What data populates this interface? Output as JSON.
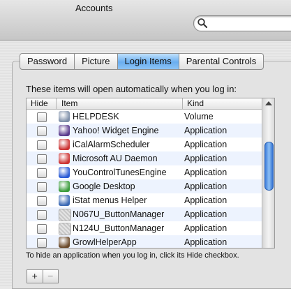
{
  "window": {
    "title": "Accounts"
  },
  "search": {
    "value": "",
    "placeholder": ""
  },
  "tabs": [
    {
      "label": "Password",
      "active": false
    },
    {
      "label": "Picture",
      "active": false
    },
    {
      "label": "Login Items",
      "active": true
    },
    {
      "label": "Parental Controls",
      "active": false
    }
  ],
  "login_items": {
    "instructions": "These items will open automatically when you log in:",
    "columns": {
      "hide": "Hide",
      "item": "Item",
      "kind": "Kind"
    },
    "rows": [
      {
        "name": "HELPDESK",
        "kind": "Volume",
        "icon": "volume-icon",
        "color": "#7d8ea8",
        "hidden": false
      },
      {
        "name": "Yahoo! Widget Engine",
        "kind": "Application",
        "icon": "yahoo-widget-icon",
        "color": "#5a3a8c",
        "hidden": false
      },
      {
        "name": "iCalAlarmScheduler",
        "kind": "Application",
        "icon": "script-app-icon",
        "color": "#c33",
        "hidden": false
      },
      {
        "name": "Microsoft AU Daemon",
        "kind": "Application",
        "icon": "script-app-icon",
        "color": "#c33",
        "hidden": false
      },
      {
        "name": "YouControlTunesEngine",
        "kind": "Application",
        "icon": "youcontrol-icon",
        "color": "#2a5bd6",
        "hidden": false
      },
      {
        "name": "Google Desktop",
        "kind": "Application",
        "icon": "google-desktop-icon",
        "color": "#3a9b3a",
        "hidden": false
      },
      {
        "name": "iStat menus Helper",
        "kind": "Application",
        "icon": "istat-icon",
        "color": "#3a68b4",
        "hidden": false
      },
      {
        "name": "N067U_ButtonManager",
        "kind": "Application",
        "icon": "generic-app-icon",
        "color": "#cfcfcf",
        "hidden": false
      },
      {
        "name": "N124U_ButtonManager",
        "kind": "Application",
        "icon": "generic-app-icon",
        "color": "#cfcfcf",
        "hidden": false
      },
      {
        "name": "GrowlHelperApp",
        "kind": "Application",
        "icon": "growl-icon",
        "color": "#6b4a2a",
        "hidden": false
      }
    ],
    "hint": "To hide an application when you log in, click its Hide checkbox.",
    "add_label": "+",
    "remove_label": "−"
  }
}
